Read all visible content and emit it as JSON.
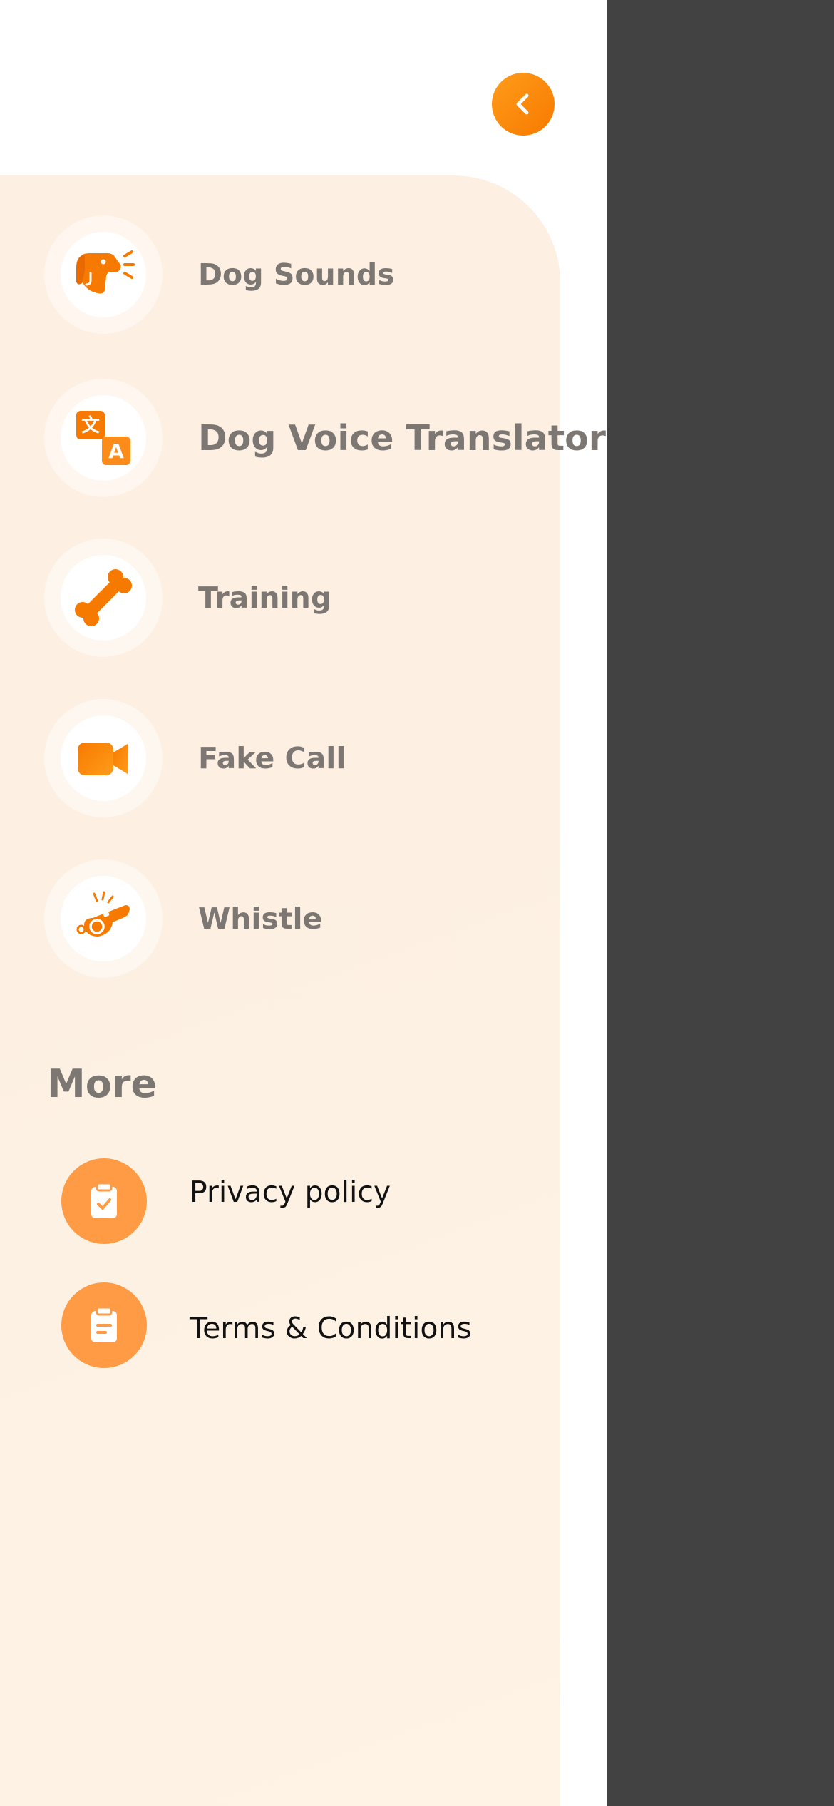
{
  "drawer": {
    "back_icon": "chevron-left-icon",
    "menu": [
      {
        "label": "Dog Sounds",
        "icon": "dog-barking-icon"
      },
      {
        "label": "Dog Voice Translator",
        "icon": "translate-icon"
      },
      {
        "label": "Training",
        "icon": "bone-icon"
      },
      {
        "label": "Fake Call",
        "icon": "video-camera-icon"
      },
      {
        "label": "Whistle",
        "icon": "whistle-icon"
      }
    ],
    "more": {
      "title": "More",
      "items": [
        {
          "label": "Privacy policy",
          "icon": "clipboard-check-icon"
        },
        {
          "label": "Terms & Conditions",
          "icon": "clipboard-text-icon"
        }
      ]
    }
  },
  "colors": {
    "accent": "#f77a00",
    "panel_bg": "#fdefe2",
    "overlay": "#424242",
    "label_gray": "#7d7773"
  }
}
